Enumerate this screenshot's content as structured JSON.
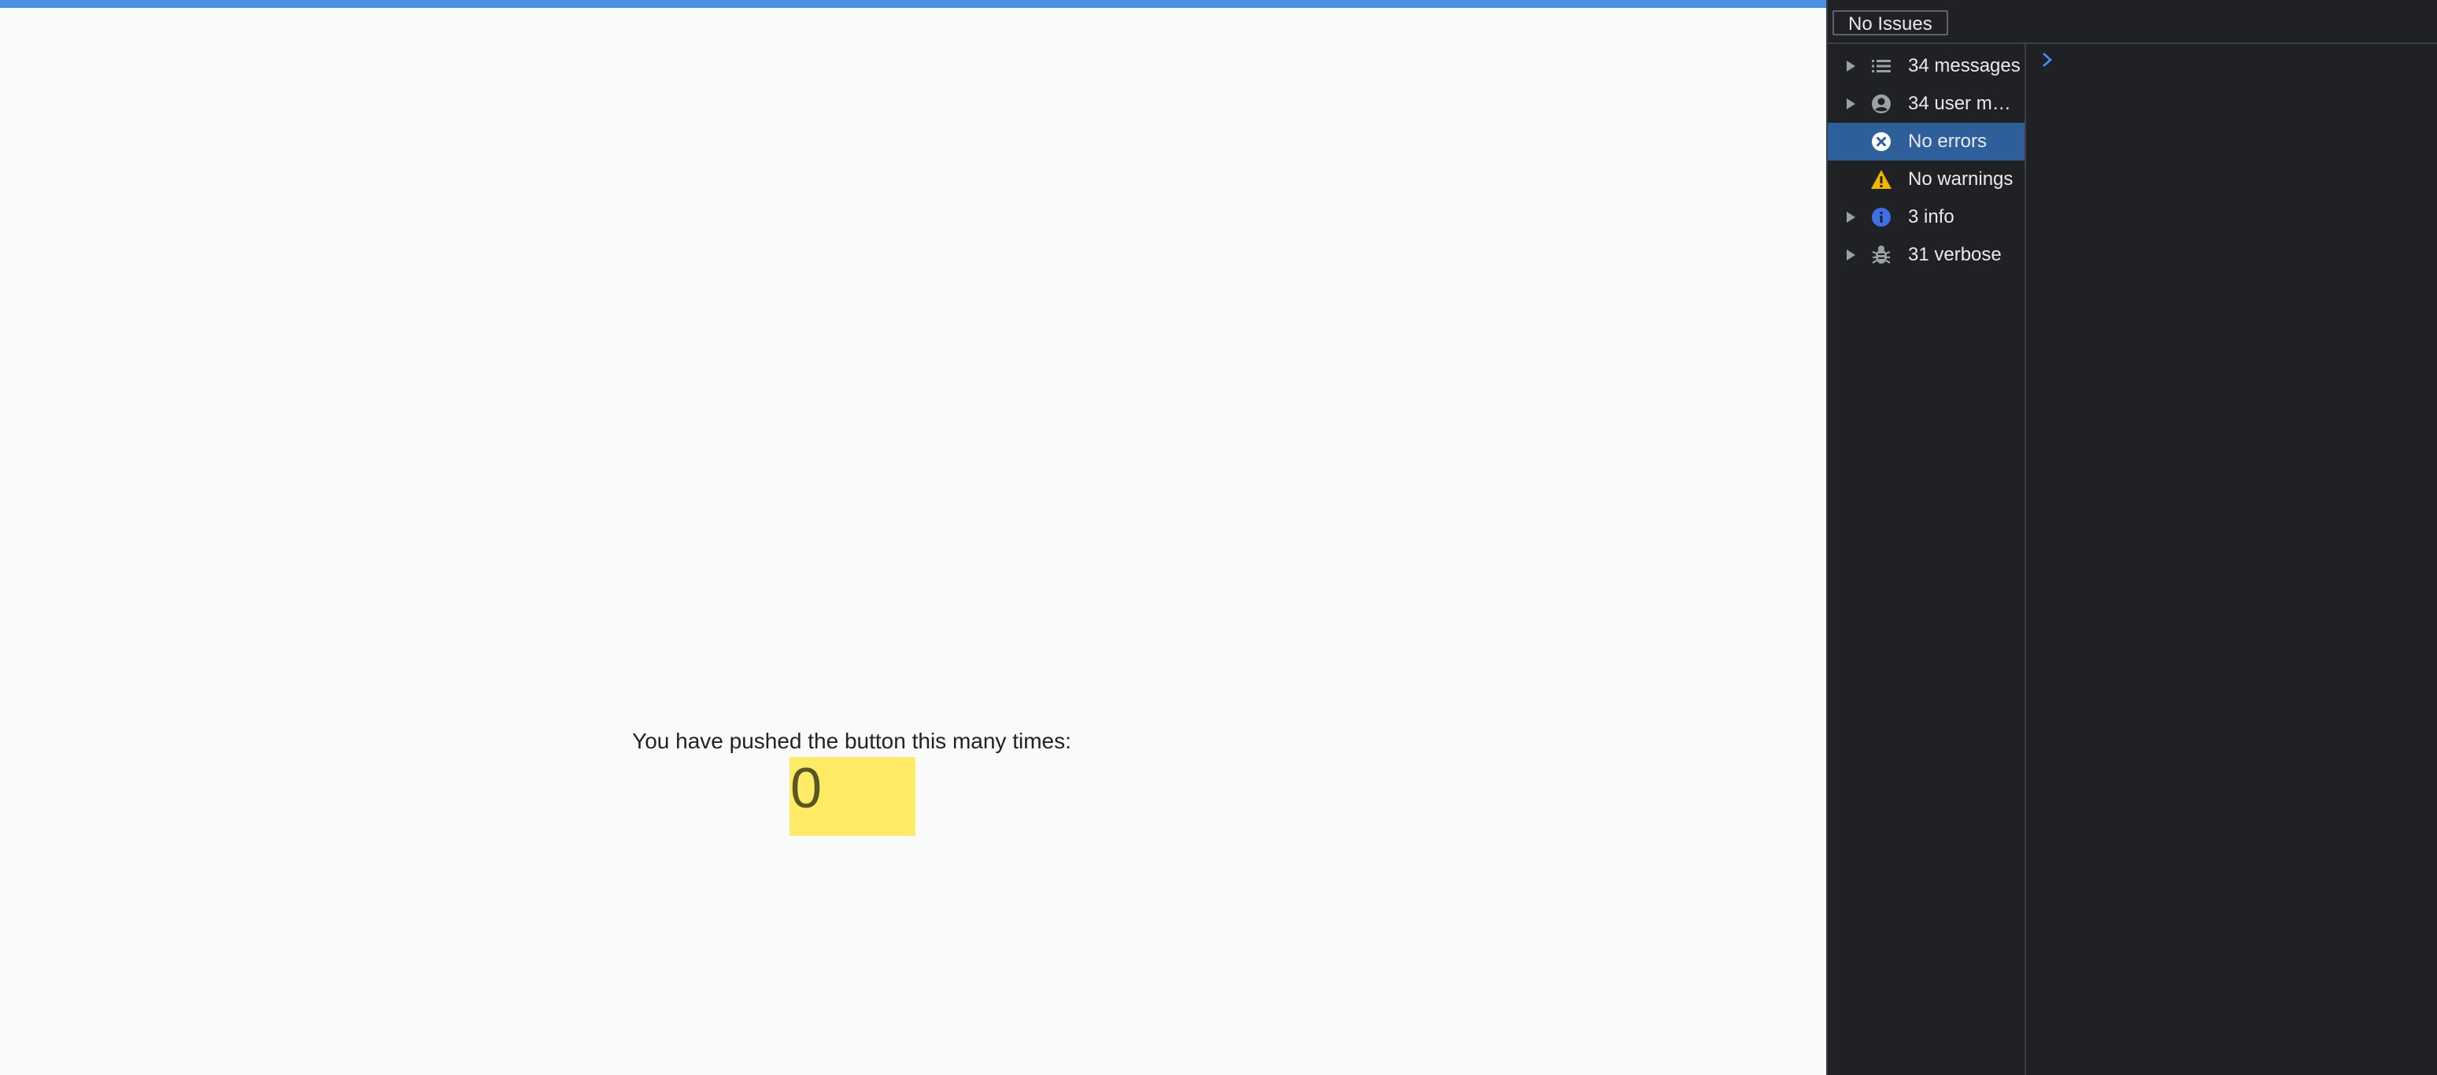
{
  "app": {
    "counter_label": "You have pushed the button this many times:",
    "counter_value": "0"
  },
  "devtools": {
    "issues_label": "No Issues",
    "sidebar": {
      "items": [
        {
          "label": "34 messages",
          "icon": "list-icon"
        },
        {
          "label": "34 user messages",
          "icon": "user-icon"
        },
        {
          "label": "No errors",
          "icon": "error-icon"
        },
        {
          "label": "No warnings",
          "icon": "warning-icon"
        },
        {
          "label": "3 info",
          "icon": "info-icon"
        },
        {
          "label": "31 verbose",
          "icon": "bug-icon"
        }
      ]
    },
    "prompt_symbol": ">"
  },
  "colors": {
    "app_bar": "#4a90e2",
    "counter_highlight": "#ffeb66",
    "devtools_bg": "#202124",
    "selected_row": "#2f5f9a"
  }
}
